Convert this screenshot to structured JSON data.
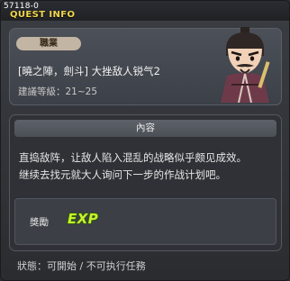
{
  "window": {
    "quest_id": "57118-0",
    "title": "QUEST INFO"
  },
  "header": {
    "job_label": "職業",
    "quest_name": "[曉之陣，劍斗] 大挫敌人锐气2",
    "level_text": "建議等級：21~25",
    "portrait_icon": "npc-portrait-icon"
  },
  "content": {
    "section_title": "內容",
    "description_lines": [
      "直捣敌阵，让敌人陷入混乱的战略似乎颇见成效。",
      "继续去找元就大人询问下一步的作战计划吧。"
    ]
  },
  "reward": {
    "label": "獎勵",
    "exp_label": "EXP"
  },
  "footer": {
    "status_text": "狀態：可開始 / 不可执行任務"
  },
  "colors": {
    "title": "#f2d54a",
    "exp": "#c8f22a",
    "badge": "#c2b5a4"
  }
}
